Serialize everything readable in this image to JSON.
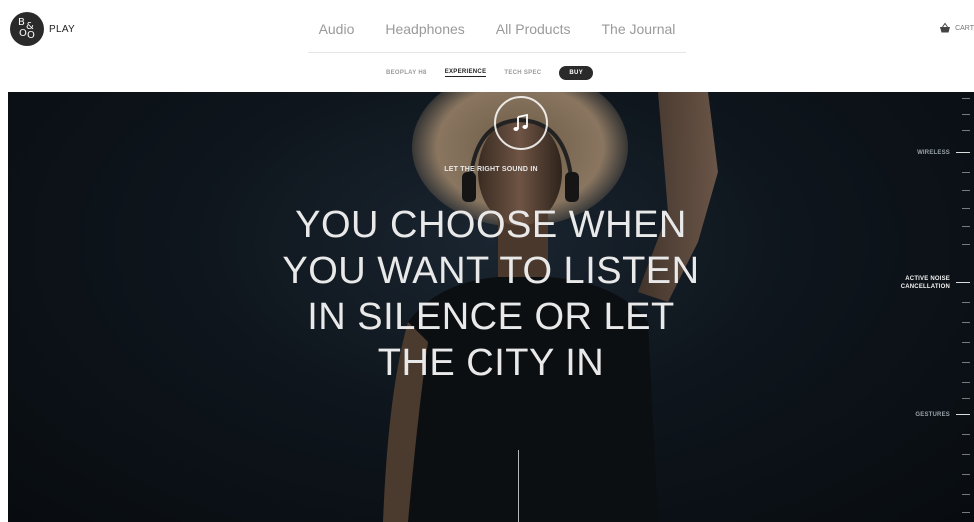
{
  "brand": {
    "logo_letters": [
      "B",
      "&",
      "O",
      "O"
    ],
    "text": "PLAY"
  },
  "nav": [
    "Audio",
    "Headphones",
    "All Products",
    "The Journal"
  ],
  "cart": {
    "label": "CART",
    "icon": "basket-icon"
  },
  "subnav": {
    "items": [
      "BEOPLAY H8",
      "EXPERIENCE",
      "TECH SPEC"
    ],
    "active_index": 1,
    "buy_label": "BUY"
  },
  "hero": {
    "icon": "music-note-icon",
    "eyebrow": "LET THE RIGHT SOUND IN",
    "headline": [
      "YOU CHOOSE WHEN",
      "YOU WANT TO LISTEN",
      "IN SILENCE OR LET",
      "THE CITY IN"
    ]
  },
  "side_nav": {
    "sections": [
      "WIRELESS",
      "ACTIVE NOISE CANCELLATION",
      "GESTURES"
    ],
    "active_index": 1
  },
  "colors": {
    "hero_bg": "#0b1117",
    "accent": "#2a2a2a",
    "text_light": "#e9e9e9"
  }
}
